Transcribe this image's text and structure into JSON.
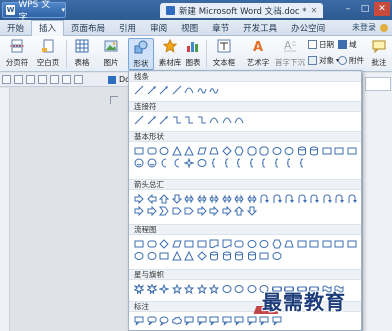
{
  "titlebar": {
    "app_label": "WPS 文字",
    "doc_title": "新建 Microsoft Word 文档.doc *",
    "newtab_symbol": "+"
  },
  "menu": {
    "tabs": [
      "开始",
      "插入",
      "页面布局",
      "引用",
      "审阅",
      "视图",
      "章节",
      "开发工具",
      "办公空间"
    ],
    "active_index": 1,
    "login_label": "未登录"
  },
  "ribbon": {
    "fenyefu": "分页符",
    "kongbaiye": "空白页",
    "biaoge": "表格",
    "tupian": "图片",
    "xingzhuang": "形状",
    "sucaiku": "素材库",
    "tubiao": "图表",
    "wenbenkuang": "文本框",
    "yishuzi": "艺术字",
    "shouzixiachen": "首字下沉",
    "riqi": "日期",
    "yu": "域",
    "duixiang": "对象",
    "fujian": "附件",
    "pizhu": "批注"
  },
  "qbar": {
    "doc_chip": "Docum"
  },
  "shapes_panel": {
    "categories": {
      "lines": "线条",
      "connectors": "连接符",
      "basic": "基本形状",
      "arrows": "箭头总汇",
      "flowchart": "流程图",
      "stars": "星与旗帜",
      "callouts": "标注"
    }
  },
  "watermark": "最需教育",
  "colors": {
    "titlebar": "#2f5a92",
    "accent": "#2f6bc1",
    "panel_border": "#9fb2c9",
    "selected": "#cfe2fa"
  }
}
